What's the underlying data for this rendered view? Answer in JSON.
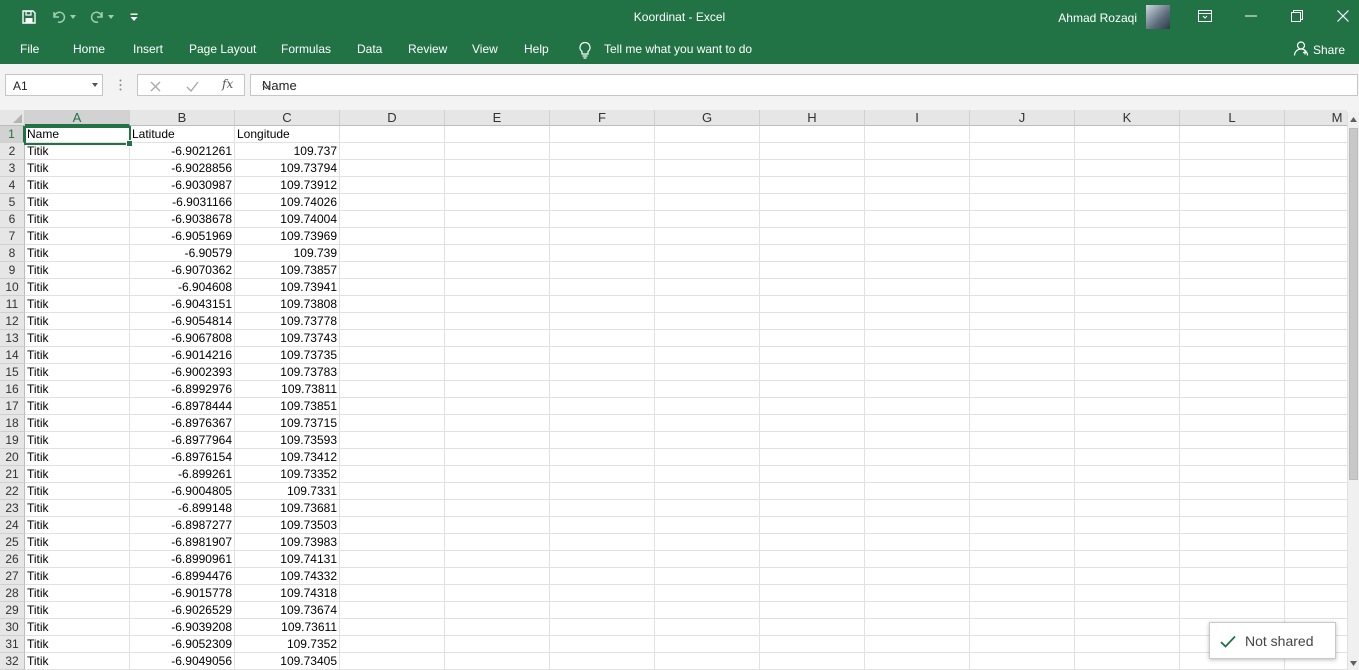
{
  "window": {
    "title": "Koordinat  -  Excel",
    "user_name": "Ahmad Rozaqi"
  },
  "menu": [
    "File",
    "Home",
    "Insert",
    "Page Layout",
    "Formulas",
    "Data",
    "Review",
    "View",
    "Help"
  ],
  "tell_me": "Tell me what you want to do",
  "share_label": "Share",
  "formula_bar": {
    "name_box": "A1",
    "fx": "fx",
    "content": "Name"
  },
  "columns": [
    "A",
    "B",
    "C",
    "D",
    "E",
    "F",
    "G",
    "H",
    "I",
    "J",
    "K",
    "L",
    "M"
  ],
  "rows": [
    [
      "Name",
      "Latitude",
      "Longitude"
    ],
    [
      "Titik",
      "-6.9021261",
      "109.737"
    ],
    [
      "Titik",
      "-6.9028856",
      "109.73794"
    ],
    [
      "Titik",
      "-6.9030987",
      "109.73912"
    ],
    [
      "Titik",
      "-6.9031166",
      "109.74026"
    ],
    [
      "Titik",
      "-6.9038678",
      "109.74004"
    ],
    [
      "Titik",
      "-6.9051969",
      "109.73969"
    ],
    [
      "Titik",
      "-6.90579",
      "109.739"
    ],
    [
      "Titik",
      "-6.9070362",
      "109.73857"
    ],
    [
      "Titik",
      "-6.904608",
      "109.73941"
    ],
    [
      "Titik",
      "-6.9043151",
      "109.73808"
    ],
    [
      "Titik",
      "-6.9054814",
      "109.73778"
    ],
    [
      "Titik",
      "-6.9067808",
      "109.73743"
    ],
    [
      "Titik",
      "-6.9014216",
      "109.73735"
    ],
    [
      "Titik",
      "-6.9002393",
      "109.73783"
    ],
    [
      "Titik",
      "-6.8992976",
      "109.73811"
    ],
    [
      "Titik",
      "-6.8978444",
      "109.73851"
    ],
    [
      "Titik",
      "-6.8976367",
      "109.73715"
    ],
    [
      "Titik",
      "-6.8977964",
      "109.73593"
    ],
    [
      "Titik",
      "-6.8976154",
      "109.73412"
    ],
    [
      "Titik",
      "-6.899261",
      "109.73352"
    ],
    [
      "Titik",
      "-6.9004805",
      "109.7331"
    ],
    [
      "Titik",
      "-6.899148",
      "109.73681"
    ],
    [
      "Titik",
      "-6.8987277",
      "109.73503"
    ],
    [
      "Titik",
      "-6.8981907",
      "109.73983"
    ],
    [
      "Titik",
      "-6.8990961",
      "109.74131"
    ],
    [
      "Titik",
      "-6.8994476",
      "109.74332"
    ],
    [
      "Titik",
      "-6.9015778",
      "109.74318"
    ],
    [
      "Titik",
      "-6.9026529",
      "109.73674"
    ],
    [
      "Titik",
      "-6.9039208",
      "109.73611"
    ],
    [
      "Titik",
      "-6.9052309",
      "109.7352"
    ],
    [
      "Titik",
      "-6.9049056",
      "109.73405"
    ]
  ],
  "toast": "Not shared"
}
